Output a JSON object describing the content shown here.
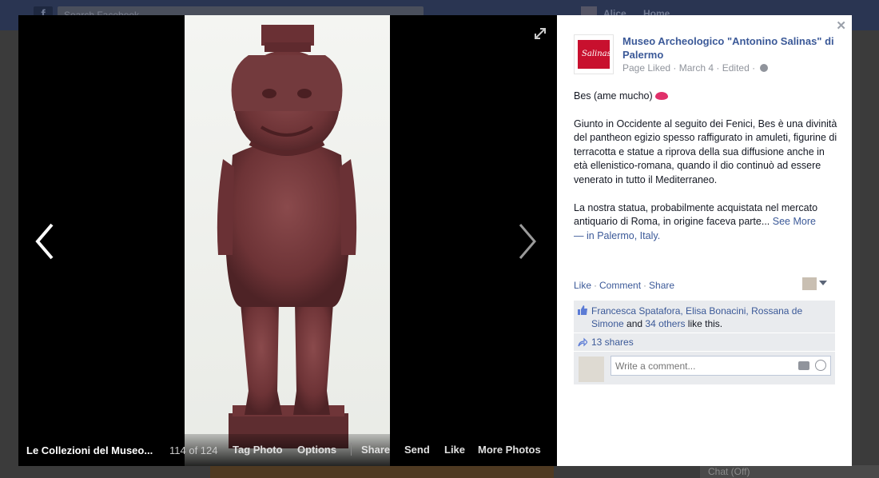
{
  "background": {
    "search_placeholder": "Search Facebook",
    "user_name": "Alice",
    "home_label": "Home",
    "chat_label": "Chat (Off)"
  },
  "viewer": {
    "album_title": "Le Collezioni del Museo...",
    "photo_counter": "114 of 124",
    "actions": {
      "tag_photo": "Tag Photo",
      "options": "Options",
      "share": "Share",
      "send": "Send",
      "like": "Like",
      "more_photos": "More Photos"
    }
  },
  "post": {
    "page_name": "Museo Archeologico \"Antonino Salinas\" di Palermo",
    "logo_text": "Salinas",
    "meta": {
      "liked": "Page Liked",
      "date": "March 4",
      "edited": "Edited"
    },
    "title_line": "Bes (ame mucho)",
    "paragraph1": "Giunto in Occidente al seguito dei Fenici, Bes è una divinità del pantheon egizio spesso raffigurato in amuleti, figurine di terracotta e statue a riprova della sua diffusione anche in età ellenistico-romana, quando il dio continuò ad essere venerato in tutto il Mediterraneo.",
    "paragraph2": "La nostra statua, probabilmente acquistata nel mercato antiquario di Roma, in origine faceva parte...",
    "see_more": "See More",
    "location_prefix": "— in",
    "location": "Palermo, Italy",
    "location_suffix": "."
  },
  "feedback": {
    "like": "Like",
    "comment": "Comment",
    "share": "Share",
    "likers": "Francesca Spatafora, Elisa Bonacini, Rossana de Simone",
    "likers_and": "and",
    "others": "34 others",
    "like_suffix": "like this.",
    "shares": "13 shares",
    "comment_placeholder": "Write a comment..."
  },
  "colors": {
    "link": "#3b5998",
    "statue": "#7b3b3e",
    "brand_red": "#c8102e"
  }
}
